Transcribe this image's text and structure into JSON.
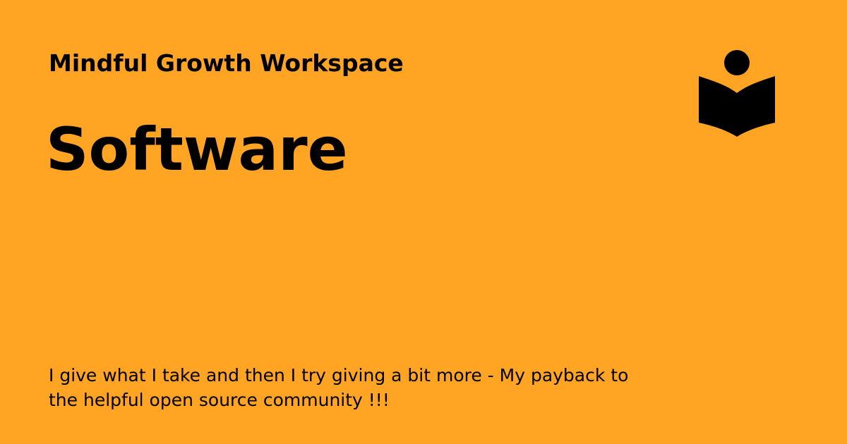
{
  "header": {
    "site_name": "Mindful Growth Workspace",
    "logo_icon": "reading-person-icon"
  },
  "main": {
    "title": "Software",
    "description": "I give what I take and then I try giving a bit more - My payback to the helpful open source community !!!"
  },
  "colors": {
    "background": "#FFA523",
    "text": "#000000"
  }
}
